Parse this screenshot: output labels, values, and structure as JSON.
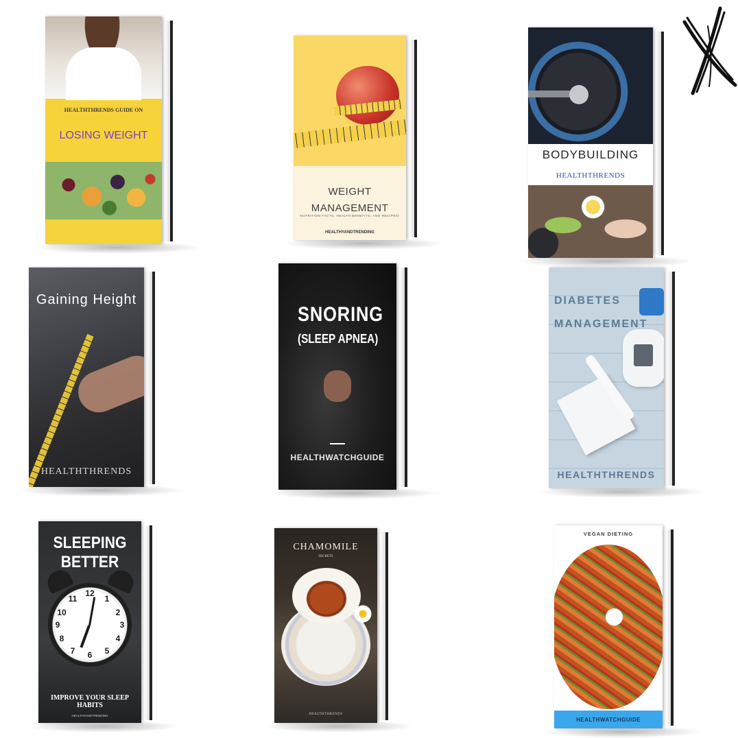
{
  "books": [
    {
      "pretitle": "HEALTHTHRENDS GUIDE ON",
      "title": "LOSING WEIGHT"
    },
    {
      "title_line1": "WEIGHT",
      "title_line2": "MANAGEMENT",
      "subtitle": "NUTRITION FACTS, HEALTH BENEFITS, AND RECIPES!",
      "footer": "HEALTHYANDTRENDING"
    },
    {
      "title": "BODYBUILDING",
      "brand": "HEALTHTHRENDS"
    },
    {
      "title": "Gaining Height",
      "footer": "HEALTHTHRENDS"
    },
    {
      "title": "SNORING",
      "subtitle": "(SLEEP APNEA)",
      "footer": "HEALTHWATCHGUIDE"
    },
    {
      "title_line1": "DIABETES",
      "title_line2": "MANAGEMENT",
      "footer": "HEALTHTHRENDS"
    },
    {
      "title_line1": "SLEEPING",
      "title_line2": "BETTER",
      "footer": "IMPROVE YOUR SLEEP HABITS",
      "footer2": "HEALTHYANDTRENDING"
    },
    {
      "title": "CHAMOMILE",
      "subtitle": "SECRETS",
      "footer": "HEALTHTHRENDS"
    },
    {
      "title": "VEGAN DIETING",
      "footer": "HEALTHWATCHGUIDE"
    }
  ],
  "clock_numbers": [
    "12",
    "1",
    "2",
    "3",
    "4",
    "5",
    "6",
    "7",
    "8",
    "9",
    "10",
    "11"
  ],
  "close_icon": "x-close-icon",
  "colors": {
    "background": "#ffffff",
    "losing_weight_title": "#7b3fc4",
    "bodybuilding_brand": "#2c4db0",
    "vegan_band": "#3aa6ec"
  }
}
